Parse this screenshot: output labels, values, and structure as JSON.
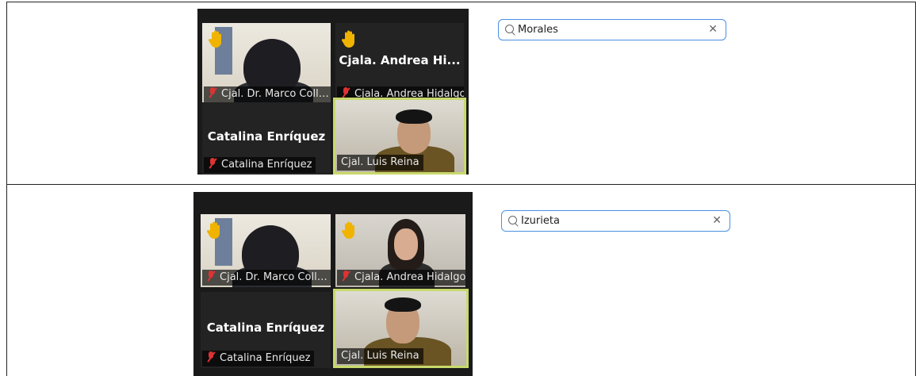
{
  "panels": [
    {
      "search": {
        "value": "Morales",
        "clear_icon": "close-icon"
      },
      "tiles": [
        {
          "name": "Cjal. Dr. Marco Colla...",
          "muted": true,
          "hand_raised": true,
          "video": true
        },
        {
          "name": "Cjala. Andrea Hidalgo",
          "big_name": "Cjala. Andrea Hi...",
          "muted": true,
          "hand_raised": true,
          "video": false
        },
        {
          "name": "Catalina Enríquez",
          "big_name": "Catalina Enríquez",
          "muted": true,
          "hand_raised": false,
          "video": false
        },
        {
          "name": "Cjal. Luis Reina",
          "muted": false,
          "hand_raised": false,
          "video": true,
          "active_speaker": true
        }
      ]
    },
    {
      "search": {
        "value": "Izurieta",
        "clear_icon": "close-icon"
      },
      "tiles": [
        {
          "name": "Cjal. Dr. Marco Colla...",
          "muted": true,
          "hand_raised": true,
          "video": true
        },
        {
          "name": "Cjala. Andrea Hidalgo",
          "muted": true,
          "hand_raised": true,
          "video": true
        },
        {
          "name": "Catalina Enríquez",
          "big_name": "Catalina Enríquez",
          "muted": true,
          "hand_raised": false,
          "video": false
        },
        {
          "name": "Cjal. Luis Reina",
          "muted": false,
          "hand_raised": false,
          "video": true,
          "active_speaker": true
        }
      ]
    }
  ],
  "colors": {
    "search_border": "#4a90e2",
    "active_speaker": "#c8d96b",
    "hand": "#f0b400",
    "muted": "#dd3333",
    "grid_bg": "#1a1a1a"
  }
}
